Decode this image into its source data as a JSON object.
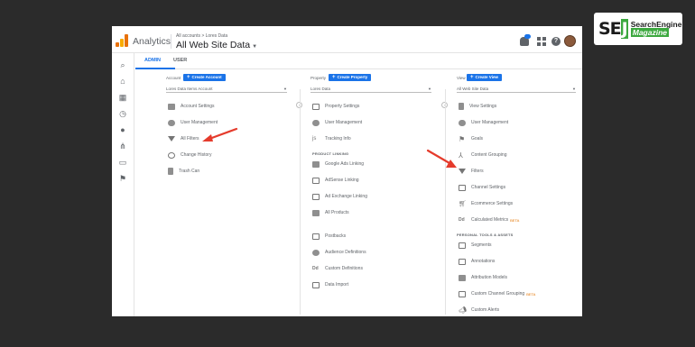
{
  "brand": {
    "mark_se": "SE",
    "mark_j": "J",
    "line1": "SearchEngine",
    "line2": "Magazine"
  },
  "header": {
    "app_name": "Analytics",
    "breadcrumb": "All accounts > Lores Data",
    "view_title": "All Web Site Data",
    "notification_count": "1"
  },
  "tabs": [
    {
      "label": "ADMIN",
      "active": true
    },
    {
      "label": "USER",
      "active": false
    }
  ],
  "account": {
    "heading": "Account",
    "create_label": "Create Account",
    "selected": "Lores Data Items Account",
    "items": [
      {
        "label": "Account Settings",
        "icon": "building-icon"
      },
      {
        "label": "User Management",
        "icon": "users-icon"
      },
      {
        "label": "All Filters",
        "icon": "filter-icon"
      },
      {
        "label": "Change History",
        "icon": "history-icon"
      },
      {
        "label": "Trash Can",
        "icon": "trash-icon"
      }
    ]
  },
  "property": {
    "heading": "Property",
    "create_label": "Create Property",
    "selected": "Lores Data",
    "items": [
      {
        "label": "Property Settings",
        "icon": "settings-doc-icon"
      },
      {
        "label": "User Management",
        "icon": "users-icon"
      },
      {
        "label": "Tracking Info",
        "icon": "code-icon"
      }
    ],
    "section_label": "PRODUCT LINKING",
    "linking_items": [
      {
        "label": "Google Ads Linking",
        "icon": "ads-icon"
      },
      {
        "label": "AdSense Linking",
        "icon": "adsense-icon"
      },
      {
        "label": "Ad Exchange Linking",
        "icon": "adx-icon"
      },
      {
        "label": "All Products",
        "icon": "products-icon"
      }
    ],
    "more_items": [
      {
        "label": "Postbacks",
        "icon": "postback-icon"
      },
      {
        "label": "Audience Definitions",
        "icon": "audience-icon"
      },
      {
        "label": "Custom Definitions",
        "icon": "dd-icon"
      },
      {
        "label": "Data Import",
        "icon": "import-icon"
      }
    ]
  },
  "view": {
    "heading": "View",
    "create_label": "Create View",
    "selected": "All Web Site Data",
    "items": [
      {
        "label": "View Settings",
        "icon": "doc-icon"
      },
      {
        "label": "User Management",
        "icon": "users-icon"
      },
      {
        "label": "Goals",
        "icon": "flag-icon"
      },
      {
        "label": "Content Grouping",
        "icon": "grouping-icon"
      },
      {
        "label": "Filters",
        "icon": "filter-icon"
      },
      {
        "label": "Channel Settings",
        "icon": "channel-icon"
      },
      {
        "label": "Ecommerce Settings",
        "icon": "cart-icon"
      },
      {
        "label": "Calculated Metrics",
        "icon": "dd-icon",
        "badge": "BETA"
      }
    ],
    "section_label": "PERSONAL TOOLS & ASSETS",
    "personal_items": [
      {
        "label": "Segments",
        "icon": "segments-icon"
      },
      {
        "label": "Annotations",
        "icon": "annotation-icon"
      },
      {
        "label": "Attribution Models",
        "icon": "attribution-icon"
      },
      {
        "label": "Custom Channel Grouping",
        "icon": "custom-channel-icon",
        "badge": "BETA"
      },
      {
        "label": "Custom Alerts",
        "icon": "megaphone-icon"
      }
    ]
  },
  "colors": {
    "accent": "#1a73e8",
    "annotation_arrow": "#e53b2c",
    "background": "#2b2b2b",
    "sej_green": "#3ca83f"
  }
}
